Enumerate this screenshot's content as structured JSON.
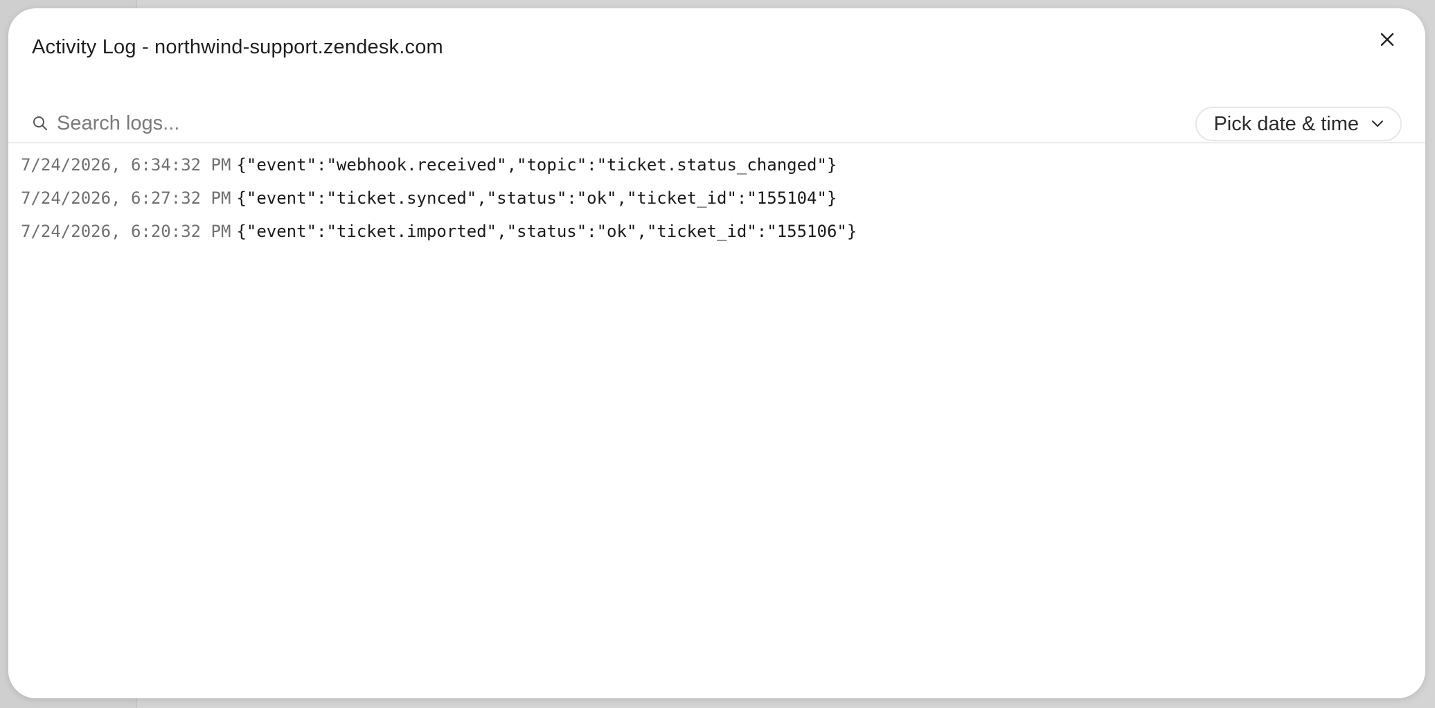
{
  "modal": {
    "title": "Activity Log - northwind-support.zendesk.com",
    "close_icon": "close-icon"
  },
  "search": {
    "placeholder": "Search logs...",
    "value": "",
    "icon": "search-icon"
  },
  "date_picker": {
    "label": "Pick date & time",
    "icon": "chevron-down-icon"
  },
  "logs": [
    {
      "timestamp": "7/24/2026, 6:34:32 PM",
      "message": "{\"event\":\"webhook.received\",\"topic\":\"ticket.status_changed\"}"
    },
    {
      "timestamp": "7/24/2026, 6:27:32 PM",
      "message": "{\"event\":\"ticket.synced\",\"status\":\"ok\",\"ticket_id\":\"155104\"}"
    },
    {
      "timestamp": "7/24/2026, 6:20:32 PM",
      "message": "{\"event\":\"ticket.imported\",\"status\":\"ok\",\"ticket_id\":\"155106\"}"
    }
  ]
}
